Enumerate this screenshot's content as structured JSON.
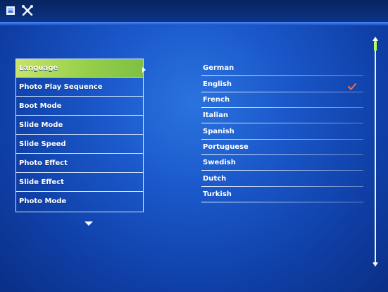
{
  "menu": {
    "items": [
      {
        "label": "Language"
      },
      {
        "label": "Photo Play Sequence"
      },
      {
        "label": "Boot Mode"
      },
      {
        "label": "Slide Mode"
      },
      {
        "label": "Slide Speed"
      },
      {
        "label": "Photo Effect"
      },
      {
        "label": "Slide Effect"
      },
      {
        "label": "Photo Mode"
      }
    ]
  },
  "languages": {
    "options": [
      {
        "label": "German"
      },
      {
        "label": "English"
      },
      {
        "label": "French"
      },
      {
        "label": "Italian"
      },
      {
        "label": "Spanish"
      },
      {
        "label": "Portuguese"
      },
      {
        "label": "Swedish"
      },
      {
        "label": "Dutch"
      },
      {
        "label": "Turkish"
      }
    ],
    "selected": "English"
  },
  "colors": {
    "background": "#1a57c9",
    "selected_item": "#96d04a",
    "check": "#ff6b3d"
  },
  "icons": {
    "top_left": [
      "photo-icon",
      "tools-icon"
    ],
    "menu_pointer": "right-triangle-icon",
    "more": "down-triangle-icon",
    "check": "checkmark-icon"
  }
}
